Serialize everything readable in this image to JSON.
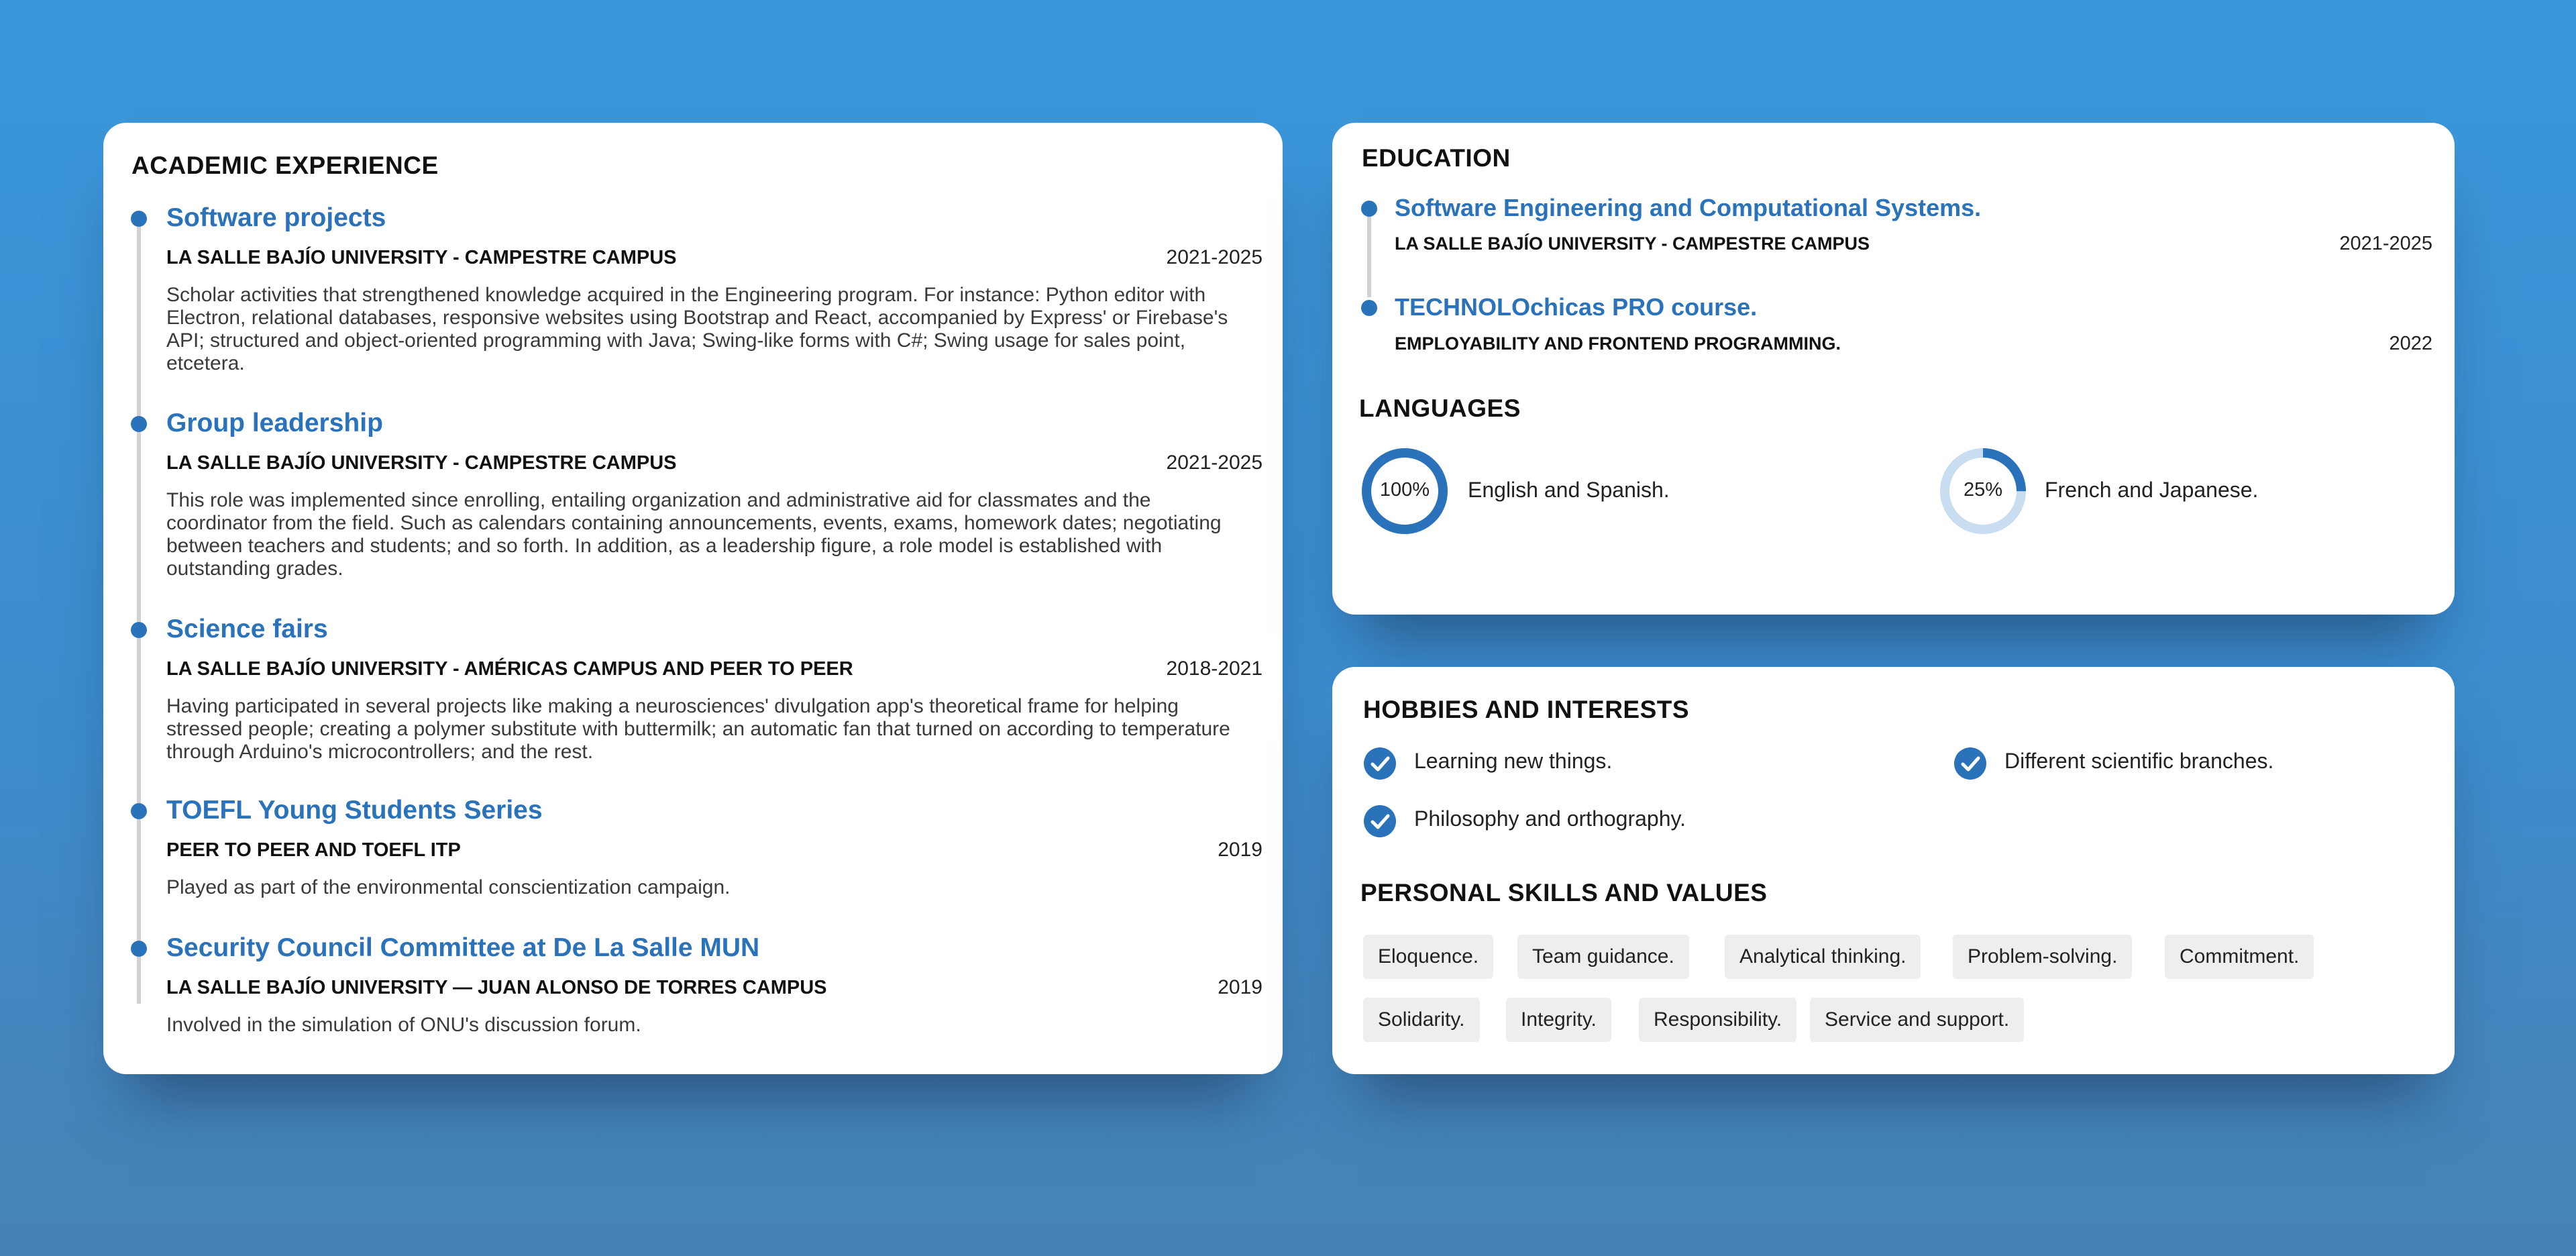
{
  "academic": {
    "title": "ACADEMIC EXPERIENCE",
    "entries": [
      {
        "title": "Software projects",
        "org": "LA SALLE BAJÍO UNIVERSITY - CAMPESTRE CAMPUS",
        "date": "2021-2025",
        "desc": "Scholar activities that strengthened knowledge acquired in the Engineering program. For instance: Python editor with Electron, relational databases, responsive websites using Bootstrap and React, accompanied by Express' or Firebase's API; structured and object-oriented programming with Java; Swing-like forms with C#; Swing usage for sales point, etcetera."
      },
      {
        "title": "Group leadership",
        "org": "LA SALLE BAJÍO UNIVERSITY - CAMPESTRE CAMPUS",
        "date": "2021-2025",
        "desc": "This role was implemented since enrolling, entailing organization and administrative aid for classmates and the coordinator from the field. Such as calendars containing announcements, events, exams, homework dates; negotiating between teachers and students; and so forth. In addition, as a leadership figure, a role model is established with outstanding grades."
      },
      {
        "title": "Science fairs",
        "org": "LA SALLE BAJÍO UNIVERSITY - AMÉRICAS CAMPUS  AND PEER TO PEER",
        "date": "2018-2021",
        "desc": "Having participated in several projects like making a neurosciences' divulgation app's theoretical frame for helping stressed people; creating a polymer substitute with buttermilk; an automatic fan that turned on according to temperature through Arduino's microcontrollers; and the rest."
      },
      {
        "title": "TOEFL Young Students Series",
        "org": "PEER TO PEER AND TOEFL ITP",
        "date": "2019",
        "desc": "Played as part of the environmental conscientization campaign."
      },
      {
        "title": "Security Council Committee at De La Salle MUN",
        "org": "LA SALLE BAJÍO UNIVERSITY — JUAN ALONSO DE TORRES CAMPUS",
        "date": "2019",
        "desc": "Involved in the simulation of ONU's discussion forum."
      }
    ]
  },
  "education": {
    "title": "EDUCATION",
    "entries": [
      {
        "title": "Software Engineering and Computational Systems.",
        "org": "LA SALLE BAJÍO UNIVERSITY - CAMPESTRE CAMPUS",
        "date": "2021-2025"
      },
      {
        "title": "TECHNOLOchicas PRO course.",
        "org": "EMPLOYABILITY AND FRONTEND PROGRAMMING.",
        "date": "2022"
      }
    ]
  },
  "languages": {
    "title": "LANGUAGES",
    "items": [
      {
        "level_label": "100%",
        "level": 1.0,
        "text": "English and Spanish."
      },
      {
        "level_label": "25%",
        "level": 0.25,
        "text": "French and Japanese."
      }
    ]
  },
  "hobbies": {
    "title": "HOBBIES AND INTERESTS",
    "items": [
      {
        "text": "Learning new things.",
        "icon": "check-circle-icon"
      },
      {
        "text": "Different scientific branches.",
        "icon": "check-circle-icon"
      },
      {
        "text": "Philosophy and orthography.",
        "icon": "check-circle-icon"
      }
    ]
  },
  "skills": {
    "title": "PERSONAL SKILLS AND VALUES",
    "items": [
      "Eloquence.",
      "Team guidance.",
      "Analytical thinking.",
      "Problem-solving.",
      "Commitment.",
      "Solidarity.",
      "Integrity.",
      "Responsibility.",
      "Service and support."
    ]
  },
  "colors": {
    "accent": "#2a72b9",
    "ring_track": "#c9ddf0",
    "chip_bg": "#eeeeee",
    "background": "#3a97db"
  }
}
